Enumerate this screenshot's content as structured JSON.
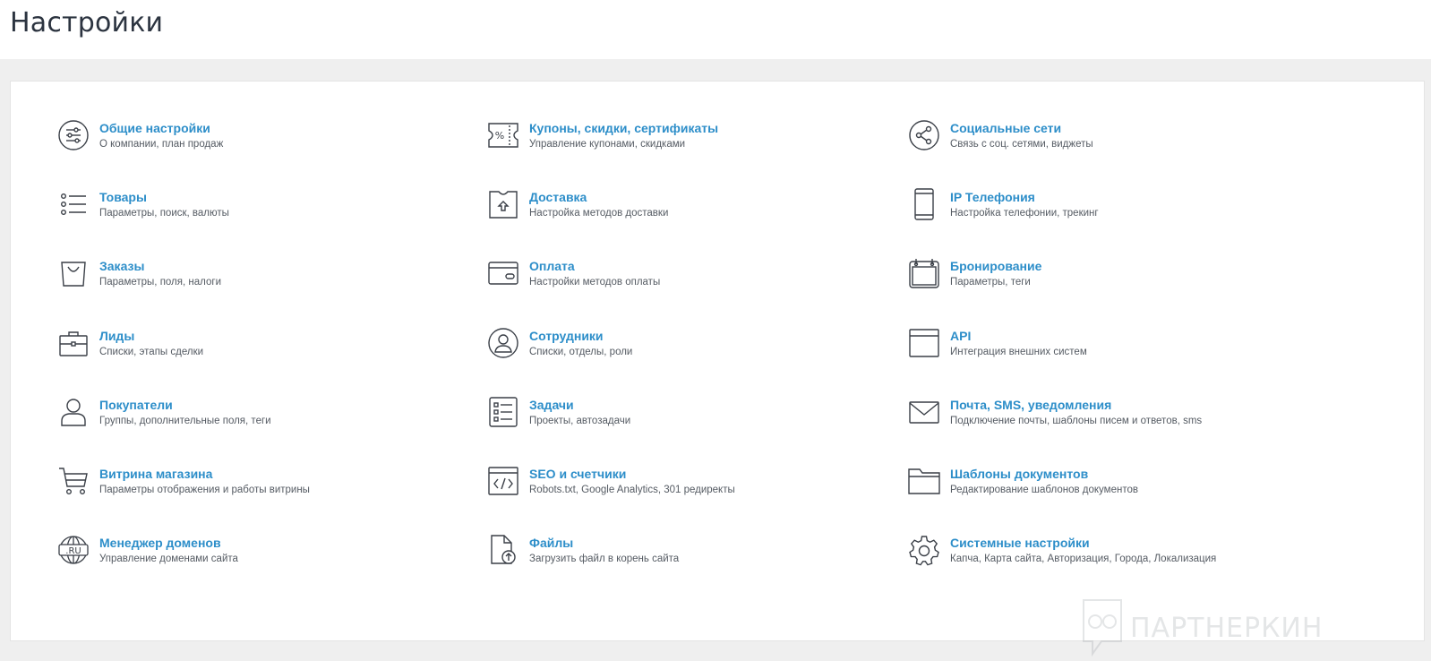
{
  "page": {
    "title": "Настройки"
  },
  "theme": {
    "link_color": "#2d8ec9",
    "text_color": "#555b63",
    "icon_color": "#3a3f47",
    "background": "#efefef"
  },
  "columns": [
    {
      "items": [
        {
          "icon": "sliders-icon",
          "title": "Общие настройки",
          "desc": "О компании, план продаж"
        },
        {
          "icon": "list-icon",
          "title": "Товары",
          "desc": "Параметры, поиск, валюты"
        },
        {
          "icon": "shopping-bag-icon",
          "title": "Заказы",
          "desc": "Параметры, поля, налоги"
        },
        {
          "icon": "briefcase-icon",
          "title": "Лиды",
          "desc": "Списки, этапы сделки"
        },
        {
          "icon": "user-icon",
          "title": "Покупатели",
          "desc": "Группы, дополнительные поля, теги"
        },
        {
          "icon": "cart-icon",
          "title": "Витрина магазина",
          "desc": "Параметры отображения и работы витрины"
        },
        {
          "icon": "globe-ru-icon",
          "title": "Менеджер доменов",
          "desc": "Управление доменами сайта",
          "icon_text": ".RU"
        }
      ]
    },
    {
      "items": [
        {
          "icon": "coupon-icon",
          "title": "Купоны, скидки, сертификаты",
          "desc": "Управление купонами, скидками"
        },
        {
          "icon": "box-icon",
          "title": "Доставка",
          "desc": "Настройка методов доставки"
        },
        {
          "icon": "credit-card-icon",
          "title": "Оплата",
          "desc": "Настройки методов оплаты"
        },
        {
          "icon": "user-circle-icon",
          "title": "Сотрудники",
          "desc": "Списки, отделы, роли"
        },
        {
          "icon": "checklist-icon",
          "title": "Задачи",
          "desc": "Проекты, автозадачи"
        },
        {
          "icon": "code-window-icon",
          "title": "SEO и счетчики",
          "desc": "Robots.txt, Google Analytics, 301 редиректы"
        },
        {
          "icon": "file-upload-icon",
          "title": "Файлы",
          "desc": "Загрузить файл в корень сайта"
        }
      ]
    },
    {
      "items": [
        {
          "icon": "share-icon",
          "title": "Социальные сети",
          "desc": "Связь с соц. сетями, виджеты"
        },
        {
          "icon": "phone-icon",
          "title": "IP Телефония",
          "desc": "Настройка телефонии, трекинг"
        },
        {
          "icon": "calendar-icon",
          "title": "Бронирование",
          "desc": "Параметры, теги"
        },
        {
          "icon": "browser-window-icon",
          "title": "API",
          "desc": "Интеграция внешних систем"
        },
        {
          "icon": "envelope-icon",
          "title": "Почта, SMS, уведомления",
          "desc": "Подключение почты, шаблоны писем и ответов, sms"
        },
        {
          "icon": "folder-icon",
          "title": "Шаблоны документов",
          "desc": "Редактирование шаблонов документов"
        },
        {
          "icon": "gear-icon",
          "title": "Системные настройки",
          "desc": "Капча, Карта сайта, Авторизация, Города, Локализация"
        }
      ]
    }
  ],
  "watermark": {
    "text": "ПАРТНЕРКИН"
  }
}
